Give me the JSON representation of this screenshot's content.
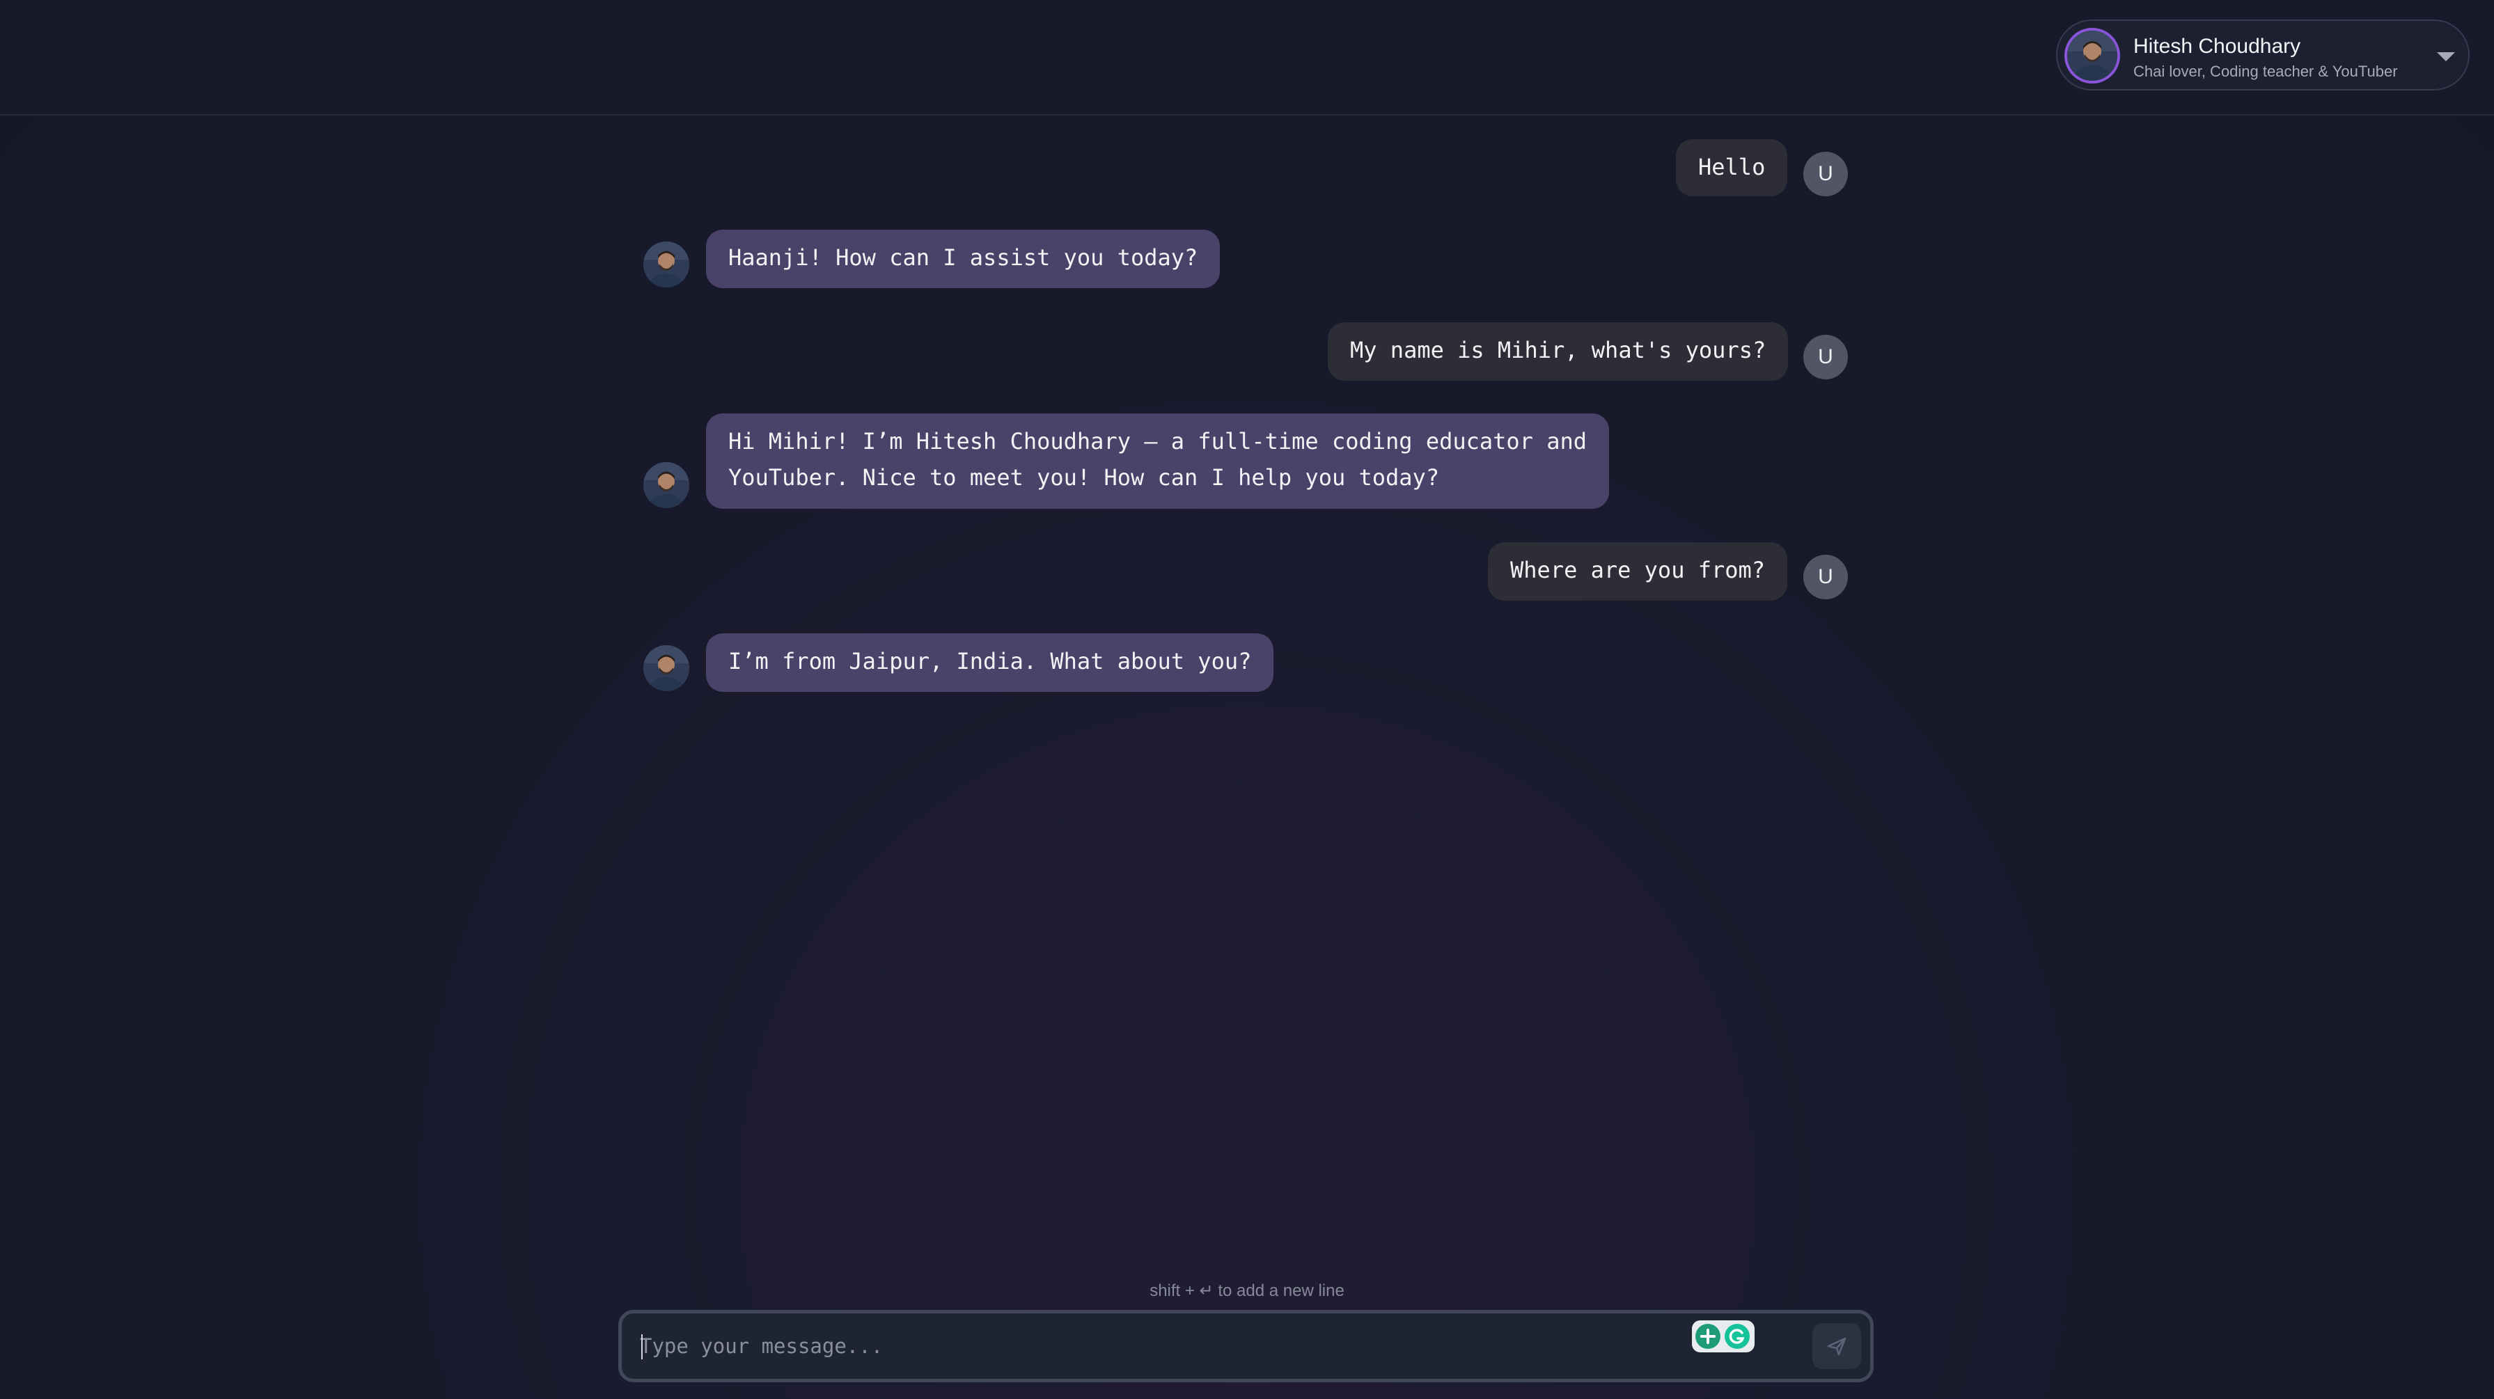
{
  "persona": {
    "name": "Hitesh Choudhary",
    "tagline": "Chai lover, Coding teacher & YouTuber"
  },
  "user_avatar_label": "U",
  "messages": [
    {
      "role": "user",
      "text": "Hello"
    },
    {
      "role": "assistant",
      "text": "Haanji! How can I assist you today?"
    },
    {
      "role": "user",
      "text": "My name is Mihir, what's yours?"
    },
    {
      "role": "assistant",
      "lines": [
        "Hi Mihir! I’m Hitesh Choudhary — a full-time coding educator and",
        "YouTuber. Nice to meet you! How can I help you today?"
      ]
    },
    {
      "role": "user",
      "text": "Where are you from?"
    },
    {
      "role": "assistant",
      "text": "I’m from Jaipur, India. What about you?"
    }
  ],
  "composer": {
    "hint": "shift + ↵ to add a new line",
    "placeholder": "Type your message...",
    "value": ""
  },
  "colors": {
    "background": "#171a2b",
    "user_bubble": "#2c2d36",
    "assistant_bubble": "#4a4268",
    "avatar_ring": "#8a55d8"
  }
}
